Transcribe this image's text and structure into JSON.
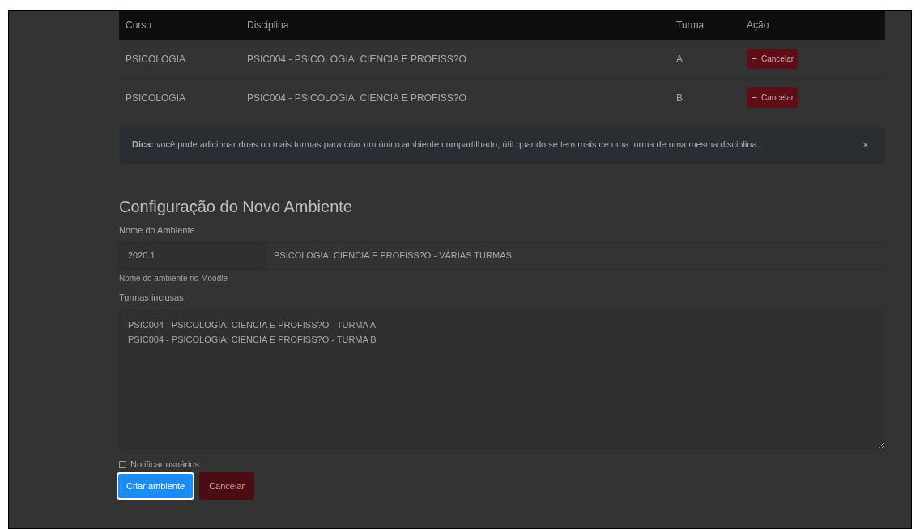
{
  "table": {
    "columns": [
      "Curso",
      "Disciplina",
      "Turma",
      "Ação"
    ],
    "rows": [
      {
        "curso": "PSICOLOGIA",
        "disciplina": "PSIC004 - PSICOLOGIA: CIENCIA E PROFISS?O",
        "turma": "A",
        "action": "Cancelar"
      },
      {
        "curso": "PSICOLOGIA",
        "disciplina": "PSIC004 - PSICOLOGIA: CIENCIA E PROFISS?O",
        "turma": "B",
        "action": "Cancelar"
      }
    ]
  },
  "tip": {
    "text": "**Dica:** você pode adicionar duas ou mais turmas para criar um único ambiente compartilhado, útil quando se tem mais de uma turma de uma mesma disciplina.",
    "close": "×"
  },
  "form": {
    "title": "Configuração do Novo Ambiente",
    "name_label": "Nome do Ambiente",
    "prefix": "2020.1",
    "name_value": "PSICOLOGIA: CIENCIA E PROFISS?O - VÁRIAS TURMAS",
    "name_help": "Nome do ambiente no Moodle",
    "classes_label": "Turmas inclusas",
    "classes_value": "PSIC004 - PSICOLOGIA: CIENCIA E PROFISS?O - TURMA A\nPSIC004 - PSICOLOGIA: CIENCIA E PROFISS?O - TURMA B",
    "notify": {
      "label": "Notificar usuários",
      "checked": false
    },
    "buttons": [
      {
        "label": "Criar ambiente",
        "kind": "primary",
        "highlighted": true
      },
      {
        "label": "Cancelar",
        "kind": "danger",
        "highlighted": false
      }
    ]
  }
}
